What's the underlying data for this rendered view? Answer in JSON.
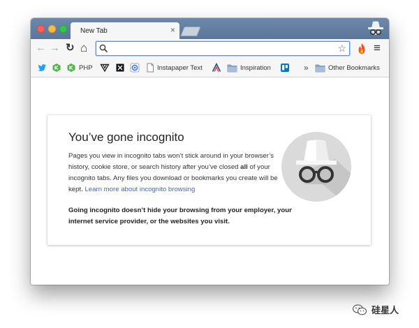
{
  "tab": {
    "title": "New Tab",
    "close_glyph": "×"
  },
  "toolbar": {
    "back_glyph": "←",
    "forward_glyph": "→",
    "reload_glyph": "↻",
    "home_glyph": "⌂",
    "menu_glyph": "≡",
    "star_glyph": "☆",
    "omnibox_value": ""
  },
  "bookmarks": {
    "items": [
      {
        "label": "",
        "icon": "twitter-icon"
      },
      {
        "label": "",
        "icon": "green-hex-icon"
      },
      {
        "label": "PHP",
        "icon": "green-hex-icon"
      },
      {
        "label": "",
        "icon": "triangle-icon"
      },
      {
        "label": "",
        "icon": "black-square-icon"
      },
      {
        "label": "",
        "icon": "blue-circle-icon"
      },
      {
        "label": "Instapaper Text",
        "icon": "page-icon"
      },
      {
        "label": "",
        "icon": "a-logo-icon"
      },
      {
        "label": "Inspiration",
        "icon": "folder-icon"
      },
      {
        "label": "",
        "icon": "trello-icon"
      }
    ],
    "overflow_glyph": "»",
    "other": "Other Bookmarks"
  },
  "incognito": {
    "heading": "You’ve gone incognito",
    "body_part1": "Pages you view in incognito tabs won’t stick around in your browser’s history, cookie store, or search history after you’ve closed ",
    "body_bold": "all",
    "body_part2": " of your incognito tabs. Any files you download or bookmarks you create will be kept. ",
    "learn_more": "Learn more about incognito browsing",
    "warning": "Going incognito doesn’t hide your browsing from your employer, your internet service provider, or the websites you visit."
  },
  "watermark": {
    "text": "硅星人"
  },
  "colors": {
    "titlebar": "#5f7b9e",
    "accent": "#4d90fe",
    "link": "#3367d6",
    "incognito_circle": "#dadada"
  }
}
